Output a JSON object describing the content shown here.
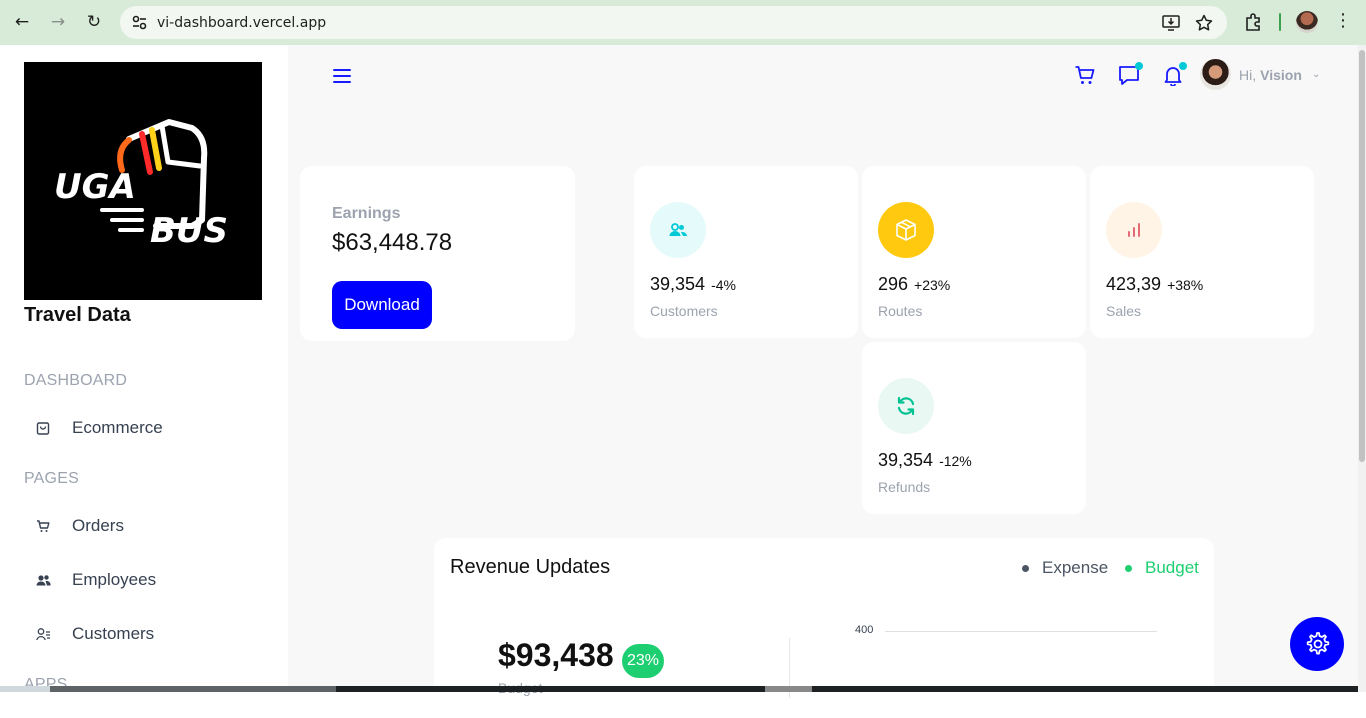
{
  "browser": {
    "url": "vi-dashboard.vercel.app"
  },
  "sidebar": {
    "brand": "Travel Data",
    "sections": [
      {
        "title": "DASHBOARD",
        "items": [
          {
            "label": "Ecommerce",
            "icon": "shopping-bag-icon"
          }
        ]
      },
      {
        "title": "PAGES",
        "items": [
          {
            "label": "Orders",
            "icon": "cart-icon"
          },
          {
            "label": "Employees",
            "icon": "users-icon"
          },
          {
            "label": "Customers",
            "icon": "customers-icon"
          }
        ]
      },
      {
        "title": "APPS",
        "items": []
      }
    ]
  },
  "header": {
    "greeting": "Hi,",
    "user_name": "Vision",
    "icons": [
      "menu-icon",
      "cart-icon",
      "chat-icon",
      "bell-icon"
    ]
  },
  "earnings": {
    "label": "Earnings",
    "value": "$63,448.78",
    "button": "Download"
  },
  "stats": [
    {
      "value": "39,354",
      "pct": "-4%",
      "label": "Customers",
      "icon": "customers-icon",
      "icon_color": "#03c9d7",
      "icon_bg": "#e5fafb",
      "pct_color": "#111111"
    },
    {
      "value": "296",
      "pct": "+23%",
      "label": "Routes",
      "icon": "box-icon",
      "icon_color": "#ffffff",
      "icon_bg": "#fec90f",
      "pct_color": "#111111"
    },
    {
      "value": "423,39",
      "pct": "+38%",
      "label": "Sales",
      "icon": "bar-chart-icon",
      "icon_color": "#e46a76",
      "icon_bg": "#fff4e5",
      "pct_color": "#111111"
    },
    {
      "value": "39,354",
      "pct": "-12%",
      "label": "Refunds",
      "icon": "refresh-icon",
      "icon_color": "#00c292",
      "icon_bg": "#e9f8f2",
      "pct_color": "#111111"
    }
  ],
  "revenue": {
    "title": "Revenue Updates",
    "legend": [
      {
        "label": "Expense",
        "color": "#4b5563"
      },
      {
        "label": "Budget",
        "color": "#1ecf71"
      }
    ],
    "total": "$93,438",
    "badge": "23%",
    "sub_label": "Budget",
    "axis_tick": "400"
  },
  "colors": {
    "accent": "#0000ff",
    "sidebar_bg": "#ffffff",
    "main_bg": "#f7f8f7"
  }
}
